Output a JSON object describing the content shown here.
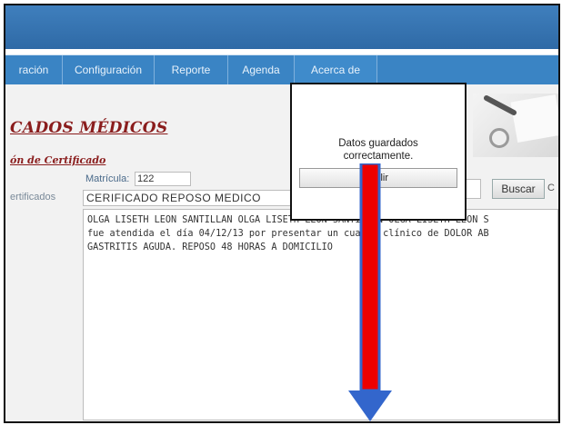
{
  "nav": {
    "tabs": [
      {
        "label": "ración"
      },
      {
        "label": "Configuración"
      },
      {
        "label": "Reporte"
      },
      {
        "label": "Agenda"
      },
      {
        "label": "Acerca de"
      }
    ]
  },
  "page": {
    "title": "CADOS MÉDICOS",
    "subtitle": "ón de Certificado"
  },
  "form": {
    "matricula_label": "Matrícula:",
    "matricula_value": "122",
    "certificados_label": "ertificados",
    "cert_type_selected": "CERIFICADO REPOSO MEDICO",
    "search_button": "Buscar",
    "right_edge_letter": "C",
    "text_lines": [
      "OLGA LISETH LEON SANTILLAN OLGA LISETH LEON SANTILLAN OLGA LISETH LEON S",
      "fue atendida el día 04/12/13 por presentar un cuadro clínico de DOLOR AB",
      "GASTRITIS AGUDA. REPOSO 48 HORAS A DOMICILIO"
    ]
  },
  "dialog": {
    "message_line1": "Datos guardados",
    "message_line2": "correctamente.",
    "button_label": "Salir"
  },
  "colors": {
    "header_blue": "#2f6aa6",
    "nav_blue": "#3a84c4",
    "title_red": "#8a1d1d",
    "arrow_red": "#ee0000",
    "arrow_blue": "#3366cc"
  }
}
